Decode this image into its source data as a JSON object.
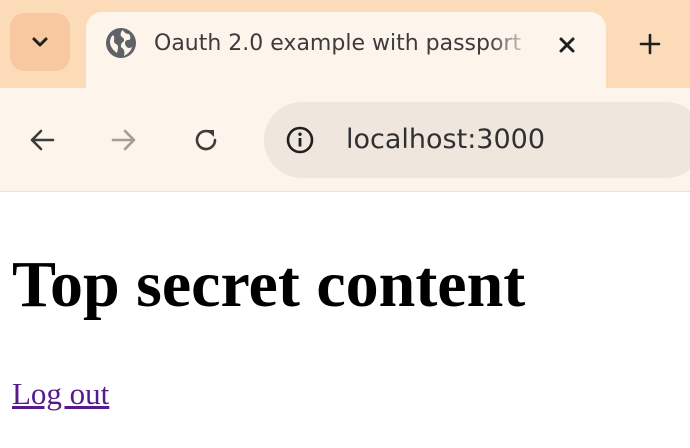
{
  "browser": {
    "tab": {
      "title": "Oauth 2.0 example with passport",
      "favicon": "globe-icon"
    },
    "toolbar": {
      "url": "localhost:3000",
      "site_info_icon": "info-icon"
    },
    "colors": {
      "tabstrip": "#fcdcb8",
      "toolbar": "#fdf4ec",
      "omnibox": "#efe6de"
    }
  },
  "page": {
    "heading": "Top secret content",
    "logout_link": "Log out",
    "link_color": "#551a8b"
  }
}
